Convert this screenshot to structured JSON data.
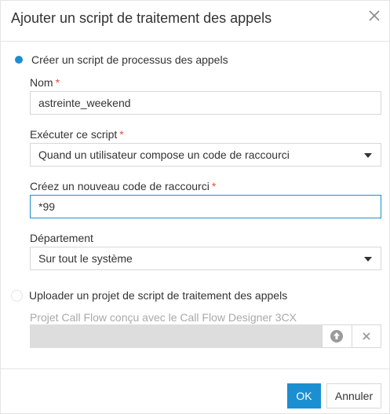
{
  "dialog": {
    "title": "Ajouter un script de traitement des appels"
  },
  "option_create": {
    "label": "Créer un script de processus des appels",
    "selected": true
  },
  "name_field": {
    "label": "Nom",
    "required_mark": "*",
    "value": "astreinte_weekend"
  },
  "execute_field": {
    "label": "Exécuter ce script",
    "required_mark": "*",
    "value": "Quand un utilisateur compose un code de raccourci"
  },
  "shortcut_field": {
    "label": "Créez un nouveau code de raccourci",
    "required_mark": "*",
    "value": "*99"
  },
  "department_field": {
    "label": "Département",
    "value": "Sur tout le système"
  },
  "option_upload": {
    "label": "Uploader un projet de script de traitement des appels",
    "selected": false,
    "hint": "Projet Call Flow conçu avec le Call Flow Designer 3CX"
  },
  "icons": {
    "close": "close-icon",
    "upload": "upload-icon",
    "clear": "clear-icon",
    "dropdown": "chevron-down-icon"
  },
  "colors": {
    "accent": "#1b8fd1",
    "required": "#e74c3c",
    "disabled_text": "#a9a9a9"
  },
  "footer": {
    "ok_label": "OK",
    "cancel_label": "Annuler"
  }
}
